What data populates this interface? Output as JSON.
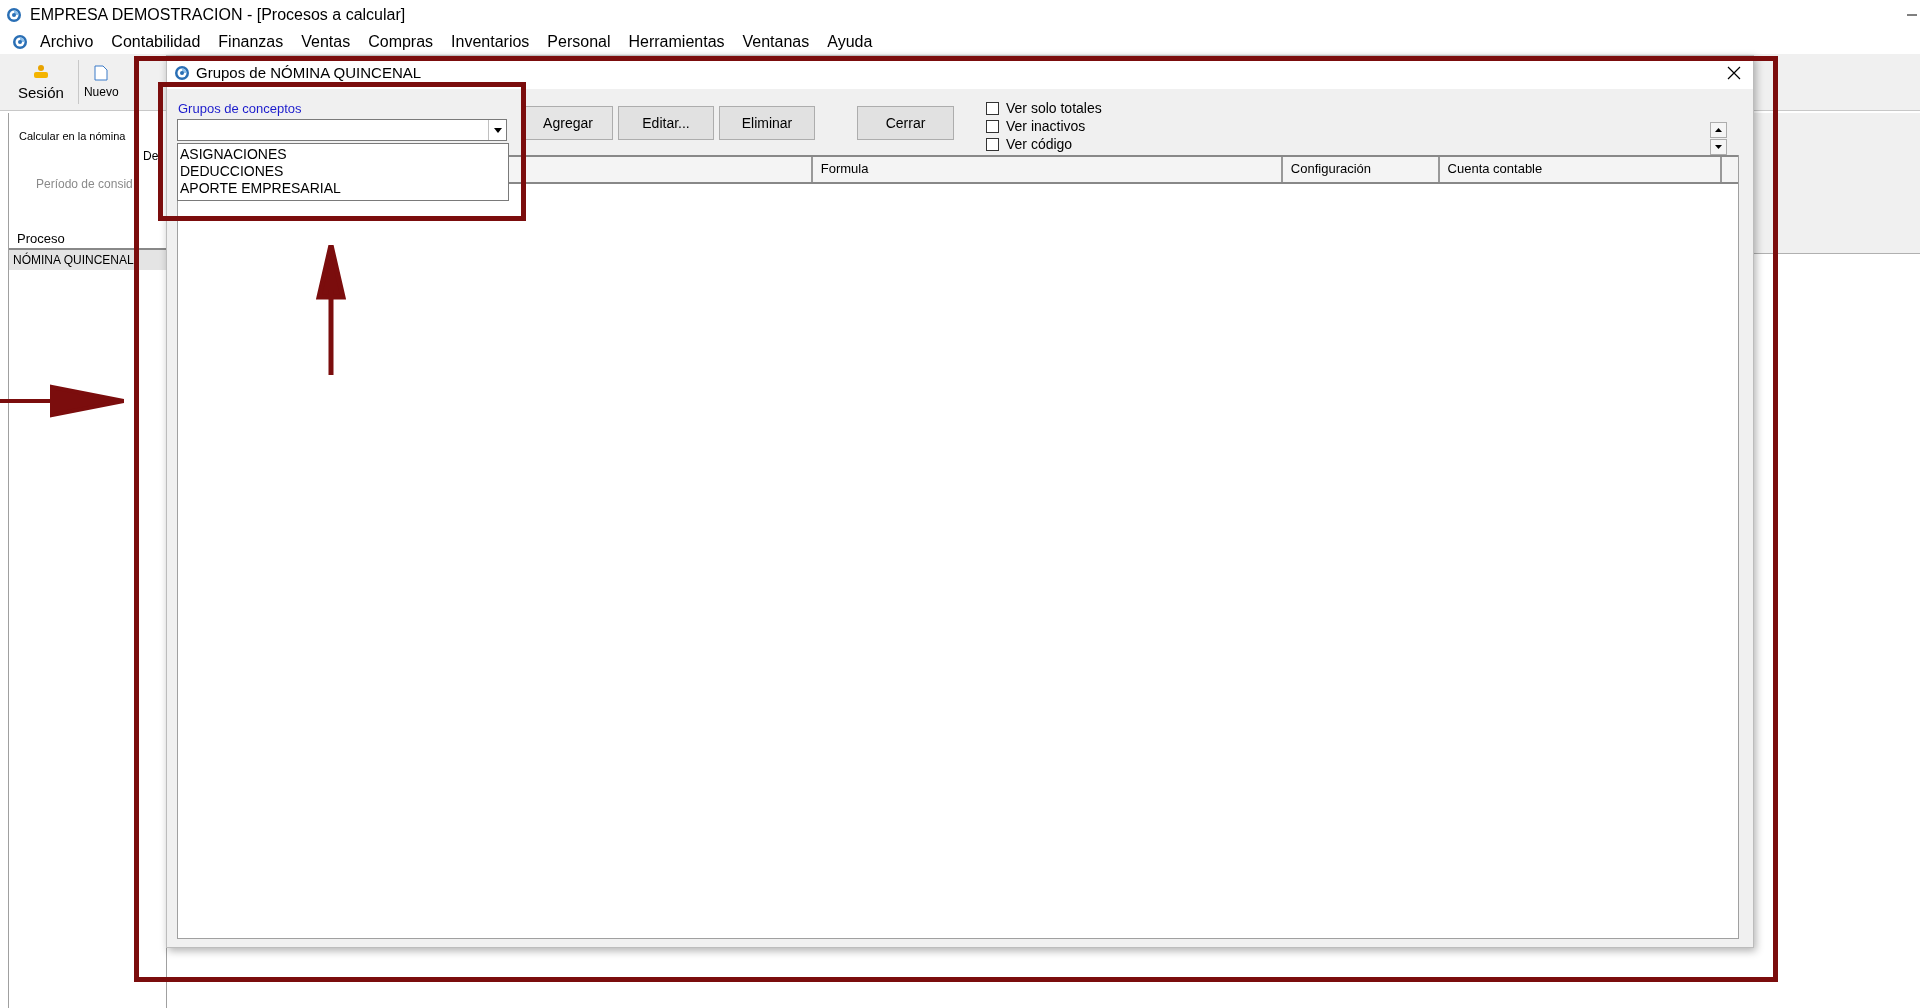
{
  "app": {
    "title": "EMPRESA DEMOSTRACION - [Procesos a calcular]",
    "menu": [
      "Archivo",
      "Contabilidad",
      "Finanzas",
      "Ventas",
      "Compras",
      "Inventarios",
      "Personal",
      "Herramientas",
      "Ventanas",
      "Ayuda"
    ]
  },
  "toolbar": [
    {
      "kind": "session",
      "label": "Sesión"
    },
    {
      "kind": "new",
      "label": "Nuevo"
    }
  ],
  "main": {
    "calc_label": "Calcular en la nómina",
    "from_label": "De",
    "period_label": "Período de consid",
    "table": {
      "columns": [
        "Proceso"
      ],
      "rows": [
        {
          "cells": [
            "NÓMINA QUINCENAL"
          ],
          "selected": true
        }
      ]
    }
  },
  "dialog": {
    "title": "Grupos de NÓMINA QUINCENAL",
    "group_label": "Grupos de conceptos",
    "combo": {
      "expanded": true,
      "options": [
        {
          "label": "ASIGNACIONES",
          "selected": false
        },
        {
          "label": "DEDUCCIONES",
          "selected": false
        },
        {
          "label": "APORTE EMPRESARIAL",
          "selected": false
        }
      ]
    },
    "buttons": [
      "Agregar",
      "Editar...",
      "Eliminar",
      "Cerrar"
    ],
    "options": [
      {
        "label": "Ver solo totales",
        "checked": false
      },
      {
        "label": "Ver inactivos",
        "checked": false
      },
      {
        "label": "Ver código",
        "checked": false
      }
    ],
    "table": {
      "columns": [
        "",
        "Formula",
        "Configuración",
        "Cuenta contable"
      ]
    }
  }
}
